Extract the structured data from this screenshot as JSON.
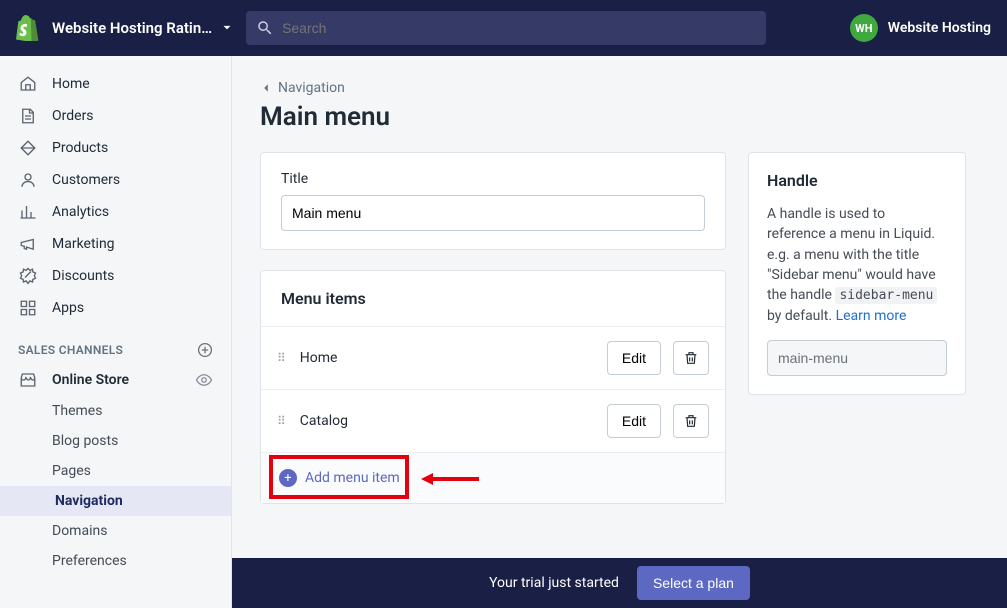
{
  "topbar": {
    "store_name": "Website Hosting Ratin…",
    "search_placeholder": "Search",
    "user_initials": "WH",
    "user_label": "Website Hosting"
  },
  "sidebar": {
    "items": [
      {
        "label": "Home",
        "icon": "home"
      },
      {
        "label": "Orders",
        "icon": "orders"
      },
      {
        "label": "Products",
        "icon": "products"
      },
      {
        "label": "Customers",
        "icon": "customers"
      },
      {
        "label": "Analytics",
        "icon": "analytics"
      },
      {
        "label": "Marketing",
        "icon": "marketing"
      },
      {
        "label": "Discounts",
        "icon": "discounts"
      },
      {
        "label": "Apps",
        "icon": "apps"
      }
    ],
    "section_title": "SALES CHANNELS",
    "channel": {
      "label": "Online Store"
    },
    "subitems": [
      "Themes",
      "Blog posts",
      "Pages",
      "Navigation",
      "Domains",
      "Preferences"
    ],
    "active_sub": "Navigation"
  },
  "page": {
    "breadcrumb": "Navigation",
    "title": "Main menu"
  },
  "title_card": {
    "label": "Title",
    "value": "Main menu"
  },
  "menu_items": {
    "heading": "Menu items",
    "rows": [
      {
        "name": "Home",
        "edit": "Edit"
      },
      {
        "name": "Catalog",
        "edit": "Edit"
      }
    ],
    "add_label": "Add menu item"
  },
  "handle_card": {
    "heading": "Handle",
    "help_pre": "A handle is used to reference a menu in Liquid. e.g. a menu with the title \"Sidebar menu\" would have the handle ",
    "code": "sidebar-menu",
    "help_post": " by default. ",
    "learn_more": "Learn more",
    "value": "main-menu"
  },
  "trial": {
    "text": "Your trial just started",
    "cta": "Select a plan"
  }
}
